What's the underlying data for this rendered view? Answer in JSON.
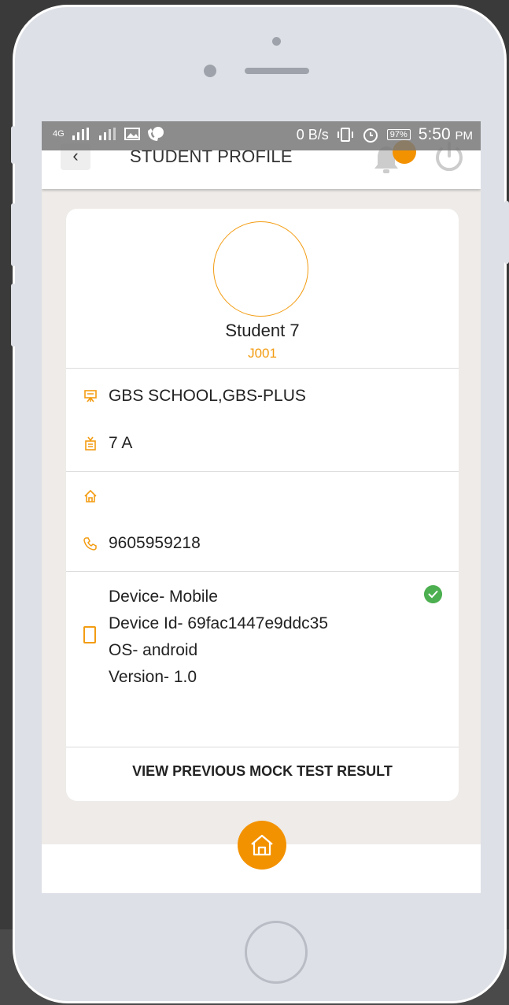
{
  "status_bar": {
    "network": "4G",
    "data_rate": "0 B/s",
    "battery": "97%",
    "time": "5:50",
    "ampm": "PM"
  },
  "app_bar": {
    "back_label": "‹",
    "title": "STUDENT PROFILE"
  },
  "profile": {
    "name": "Student 7",
    "id": "J001",
    "school": "GBS SCHOOL,GBS-PLUS",
    "class": "7 A",
    "address": "",
    "phone": "9605959218"
  },
  "device": {
    "type": "Device- Mobile",
    "id": "Device Id- 69fac1447e9ddc35",
    "os": "OS- android",
    "version": "Version- 1.0"
  },
  "actions": {
    "mock_test": "VIEW PREVIOUS MOCK TEST RESULT"
  },
  "colors": {
    "accent": "#f39c12",
    "verified": "#4caf50"
  },
  "icons": [
    "back-icon",
    "bell-icon",
    "power-icon",
    "school-icon",
    "class-icon",
    "home-address-icon",
    "phone-icon",
    "device-icon",
    "check-icon",
    "home-icon"
  ]
}
